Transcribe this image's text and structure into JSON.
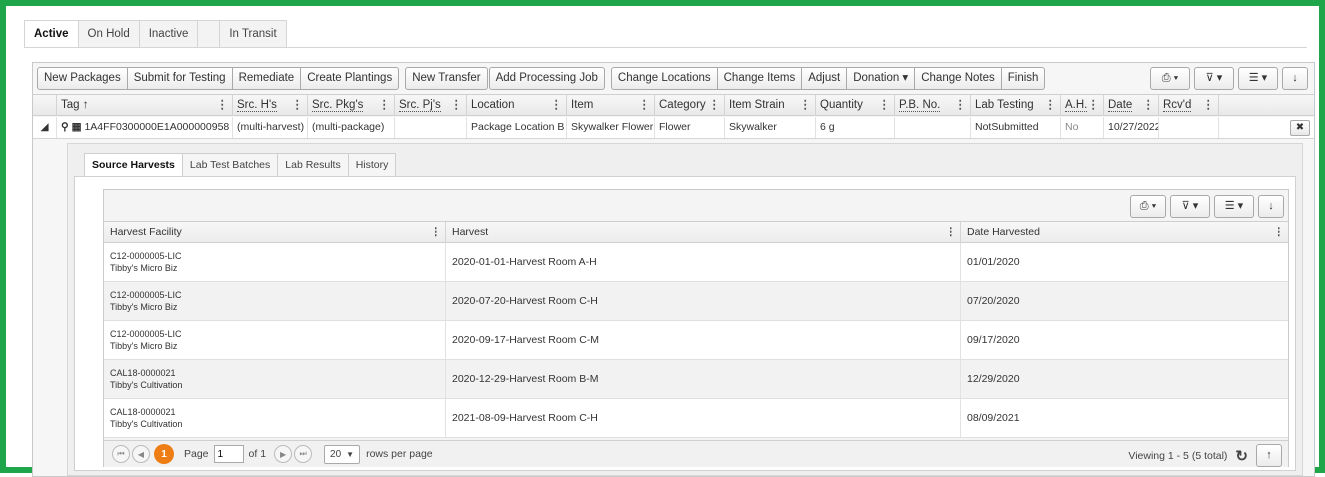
{
  "status_tabs": [
    {
      "label": "Active",
      "active": true
    },
    {
      "label": "On Hold"
    },
    {
      "label": "Inactive"
    },
    {
      "label": ""
    },
    {
      "label": "In Transit"
    }
  ],
  "toolbar": {
    "buttons": [
      "New Packages",
      "Submit for Testing",
      "Remediate",
      "Create Plantings",
      "New Transfer",
      "Add Processing Job",
      "Change Locations",
      "Change Items",
      "Adjust",
      "Donation ▾",
      "Change Notes",
      "Finish"
    ],
    "icons": [
      "printer-icon",
      "filter-icon",
      "columns-icon",
      "download-icon"
    ]
  },
  "grid": {
    "columns": [
      "Tag ↑",
      "Src. H's",
      "Src. Pkg's",
      "Src. Pj's",
      "Location",
      "Item",
      "Category",
      "Item Strain",
      "Quantity",
      "P.B. No.",
      "Lab Testing",
      "A.H.",
      "Date",
      "Rcv'd"
    ],
    "row": {
      "tag": "1A4FF0300000E1A000000958",
      "src_harvests": "(multi-harvest)",
      "src_packages": "(multi-package)",
      "src_projects": "",
      "location": "Package Location B",
      "item": "Skywalker Flower",
      "category": "Flower",
      "item_strain": "Skywalker",
      "quantity": "6 g",
      "pb_no": "",
      "lab_testing": "NotSubmitted",
      "ah": "No",
      "date": "10/27/2022",
      "received": ""
    }
  },
  "detail": {
    "tabs": [
      {
        "label": "Source Harvests",
        "active": true
      },
      {
        "label": "Lab Test Batches"
      },
      {
        "label": "Lab Results"
      },
      {
        "label": "History"
      }
    ],
    "columns": [
      "Harvest Facility",
      "Harvest",
      "Date Harvested"
    ],
    "rows": [
      {
        "facility_license": "C12-0000005-LIC",
        "facility_name": "Tibby's Micro Biz",
        "harvest": "2020-01-01-Harvest Room A-H",
        "date": "01/01/2020"
      },
      {
        "facility_license": "C12-0000005-LIC",
        "facility_name": "Tibby's Micro Biz",
        "harvest": "2020-07-20-Harvest Room C-H",
        "date": "07/20/2020"
      },
      {
        "facility_license": "C12-0000005-LIC",
        "facility_name": "Tibby's Micro Biz",
        "harvest": "2020-09-17-Harvest Room C-M",
        "date": "09/17/2020"
      },
      {
        "facility_license": "CAL18-0000021",
        "facility_name": "Tibby's Cultivation",
        "harvest": "2020-12-29-Harvest Room B-M",
        "date": "12/29/2020"
      },
      {
        "facility_license": "CAL18-0000021",
        "facility_name": "Tibby's Cultivation",
        "harvest": "2021-08-09-Harvest Room C-H",
        "date": "08/09/2021"
      }
    ],
    "pager": {
      "current": "1",
      "page_label": "Page",
      "page_value": "1",
      "of_label": "of 1",
      "rows_value": "20",
      "rows_label": "rows per page",
      "viewing": "Viewing 1 - 5 (5 total)"
    }
  }
}
